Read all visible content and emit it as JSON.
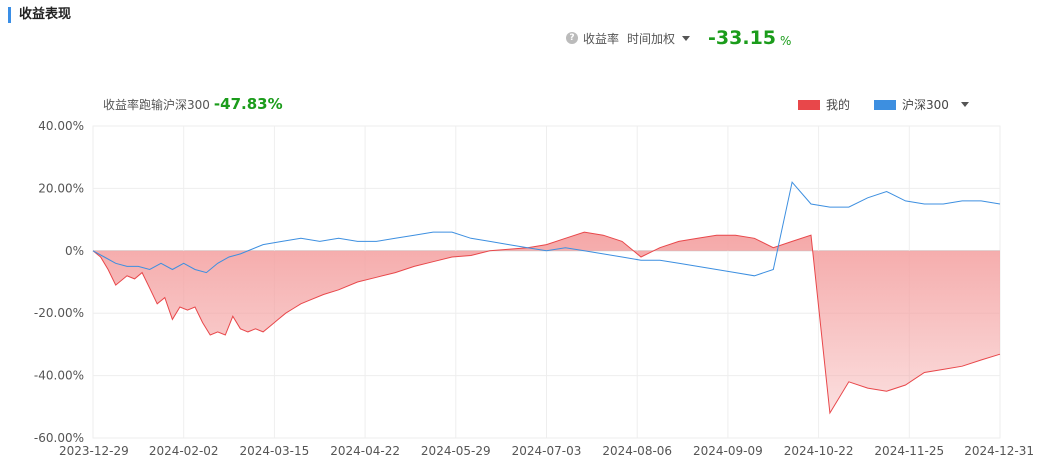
{
  "section_title": "收益表现",
  "metric": {
    "help_icon": "?",
    "label": "收益率",
    "mode": "时间加权",
    "value": "-33.15",
    "unit": "%"
  },
  "caption": {
    "label": "收益率跑输沪深300",
    "value": "-47.83%"
  },
  "colors": {
    "mine": "#e8474a",
    "mine_fill": "#f4a3a3",
    "benchmark": "#3d8fe0",
    "grid": "#eeeeee",
    "zero_line": "#cccccc"
  },
  "chart_data": {
    "type": "area",
    "y_ticks": [
      "40.00%",
      "20.00%",
      "0%",
      "-20.00%",
      "-40.00%",
      "-60.00%"
    ],
    "x_ticks": [
      "2023-12-29",
      "2024-02-02",
      "2024-03-15",
      "2024-04-22",
      "2024-05-29",
      "2024-07-03",
      "2024-08-06",
      "2024-09-09",
      "2024-10-22",
      "2024-11-25",
      "2024-12-31"
    ],
    "ylim": [
      -60,
      40
    ],
    "grid": true,
    "legend": "top-right",
    "x_range": [
      0,
      240
    ],
    "series": [
      {
        "name": "我的",
        "x": [
          0,
          2,
          4,
          6,
          9,
          11,
          13,
          15,
          17,
          19,
          21,
          23,
          25,
          27,
          29,
          31,
          33,
          35,
          37,
          39,
          41,
          43,
          45,
          47,
          49,
          51,
          53,
          55,
          57,
          61,
          65,
          70,
          75,
          80,
          85,
          90,
          95,
          100,
          105,
          110,
          115,
          120,
          125,
          130,
          135,
          140,
          145,
          150,
          155,
          160,
          165,
          170,
          175,
          180,
          185,
          190,
          195,
          200,
          205,
          210,
          215,
          220,
          225,
          230,
          235,
          240
        ],
        "values": [
          0,
          -2,
          -6,
          -11,
          -8,
          -9,
          -7,
          -12,
          -17,
          -15,
          -22,
          -18,
          -19,
          -18,
          -23,
          -27,
          -26,
          -27,
          -21,
          -25,
          -26,
          -25,
          -26,
          -24,
          -22,
          -20,
          -18.5,
          -17,
          -16,
          -14,
          -12.5,
          -10,
          -8.5,
          -7,
          -5,
          -3.5,
          -2,
          -1.5,
          0,
          0.5,
          1,
          2,
          4,
          6,
          5,
          3,
          -2,
          1,
          3,
          4,
          5,
          5,
          4,
          1,
          3,
          5,
          -52,
          -42,
          -44,
          -45,
          -43,
          -39,
          -38,
          -37,
          -35,
          -33.15
        ]
      },
      {
        "name": "沪深300",
        "x": [
          0,
          3,
          6,
          9,
          12,
          15,
          18,
          21,
          24,
          27,
          30,
          33,
          36,
          39,
          45,
          50,
          55,
          60,
          65,
          70,
          75,
          80,
          85,
          90,
          95,
          100,
          105,
          110,
          115,
          120,
          125,
          130,
          135,
          140,
          145,
          150,
          155,
          160,
          165,
          170,
          175,
          180,
          185,
          190,
          195,
          200,
          205,
          210,
          215,
          220,
          225,
          230,
          235,
          240
        ],
        "values": [
          0,
          -2,
          -4,
          -5,
          -5,
          -6,
          -4,
          -6,
          -4,
          -6,
          -7,
          -4,
          -2,
          -1,
          2,
          3,
          4,
          3,
          4,
          3,
          3,
          4,
          5,
          6,
          6,
          4,
          3,
          2,
          1,
          0,
          1,
          0,
          -1,
          -2,
          -3,
          -3,
          -4,
          -5,
          -6,
          -7,
          -8,
          -6,
          22,
          15,
          14,
          14,
          17,
          19,
          16,
          15,
          15,
          16,
          16,
          15
        ]
      }
    ]
  }
}
